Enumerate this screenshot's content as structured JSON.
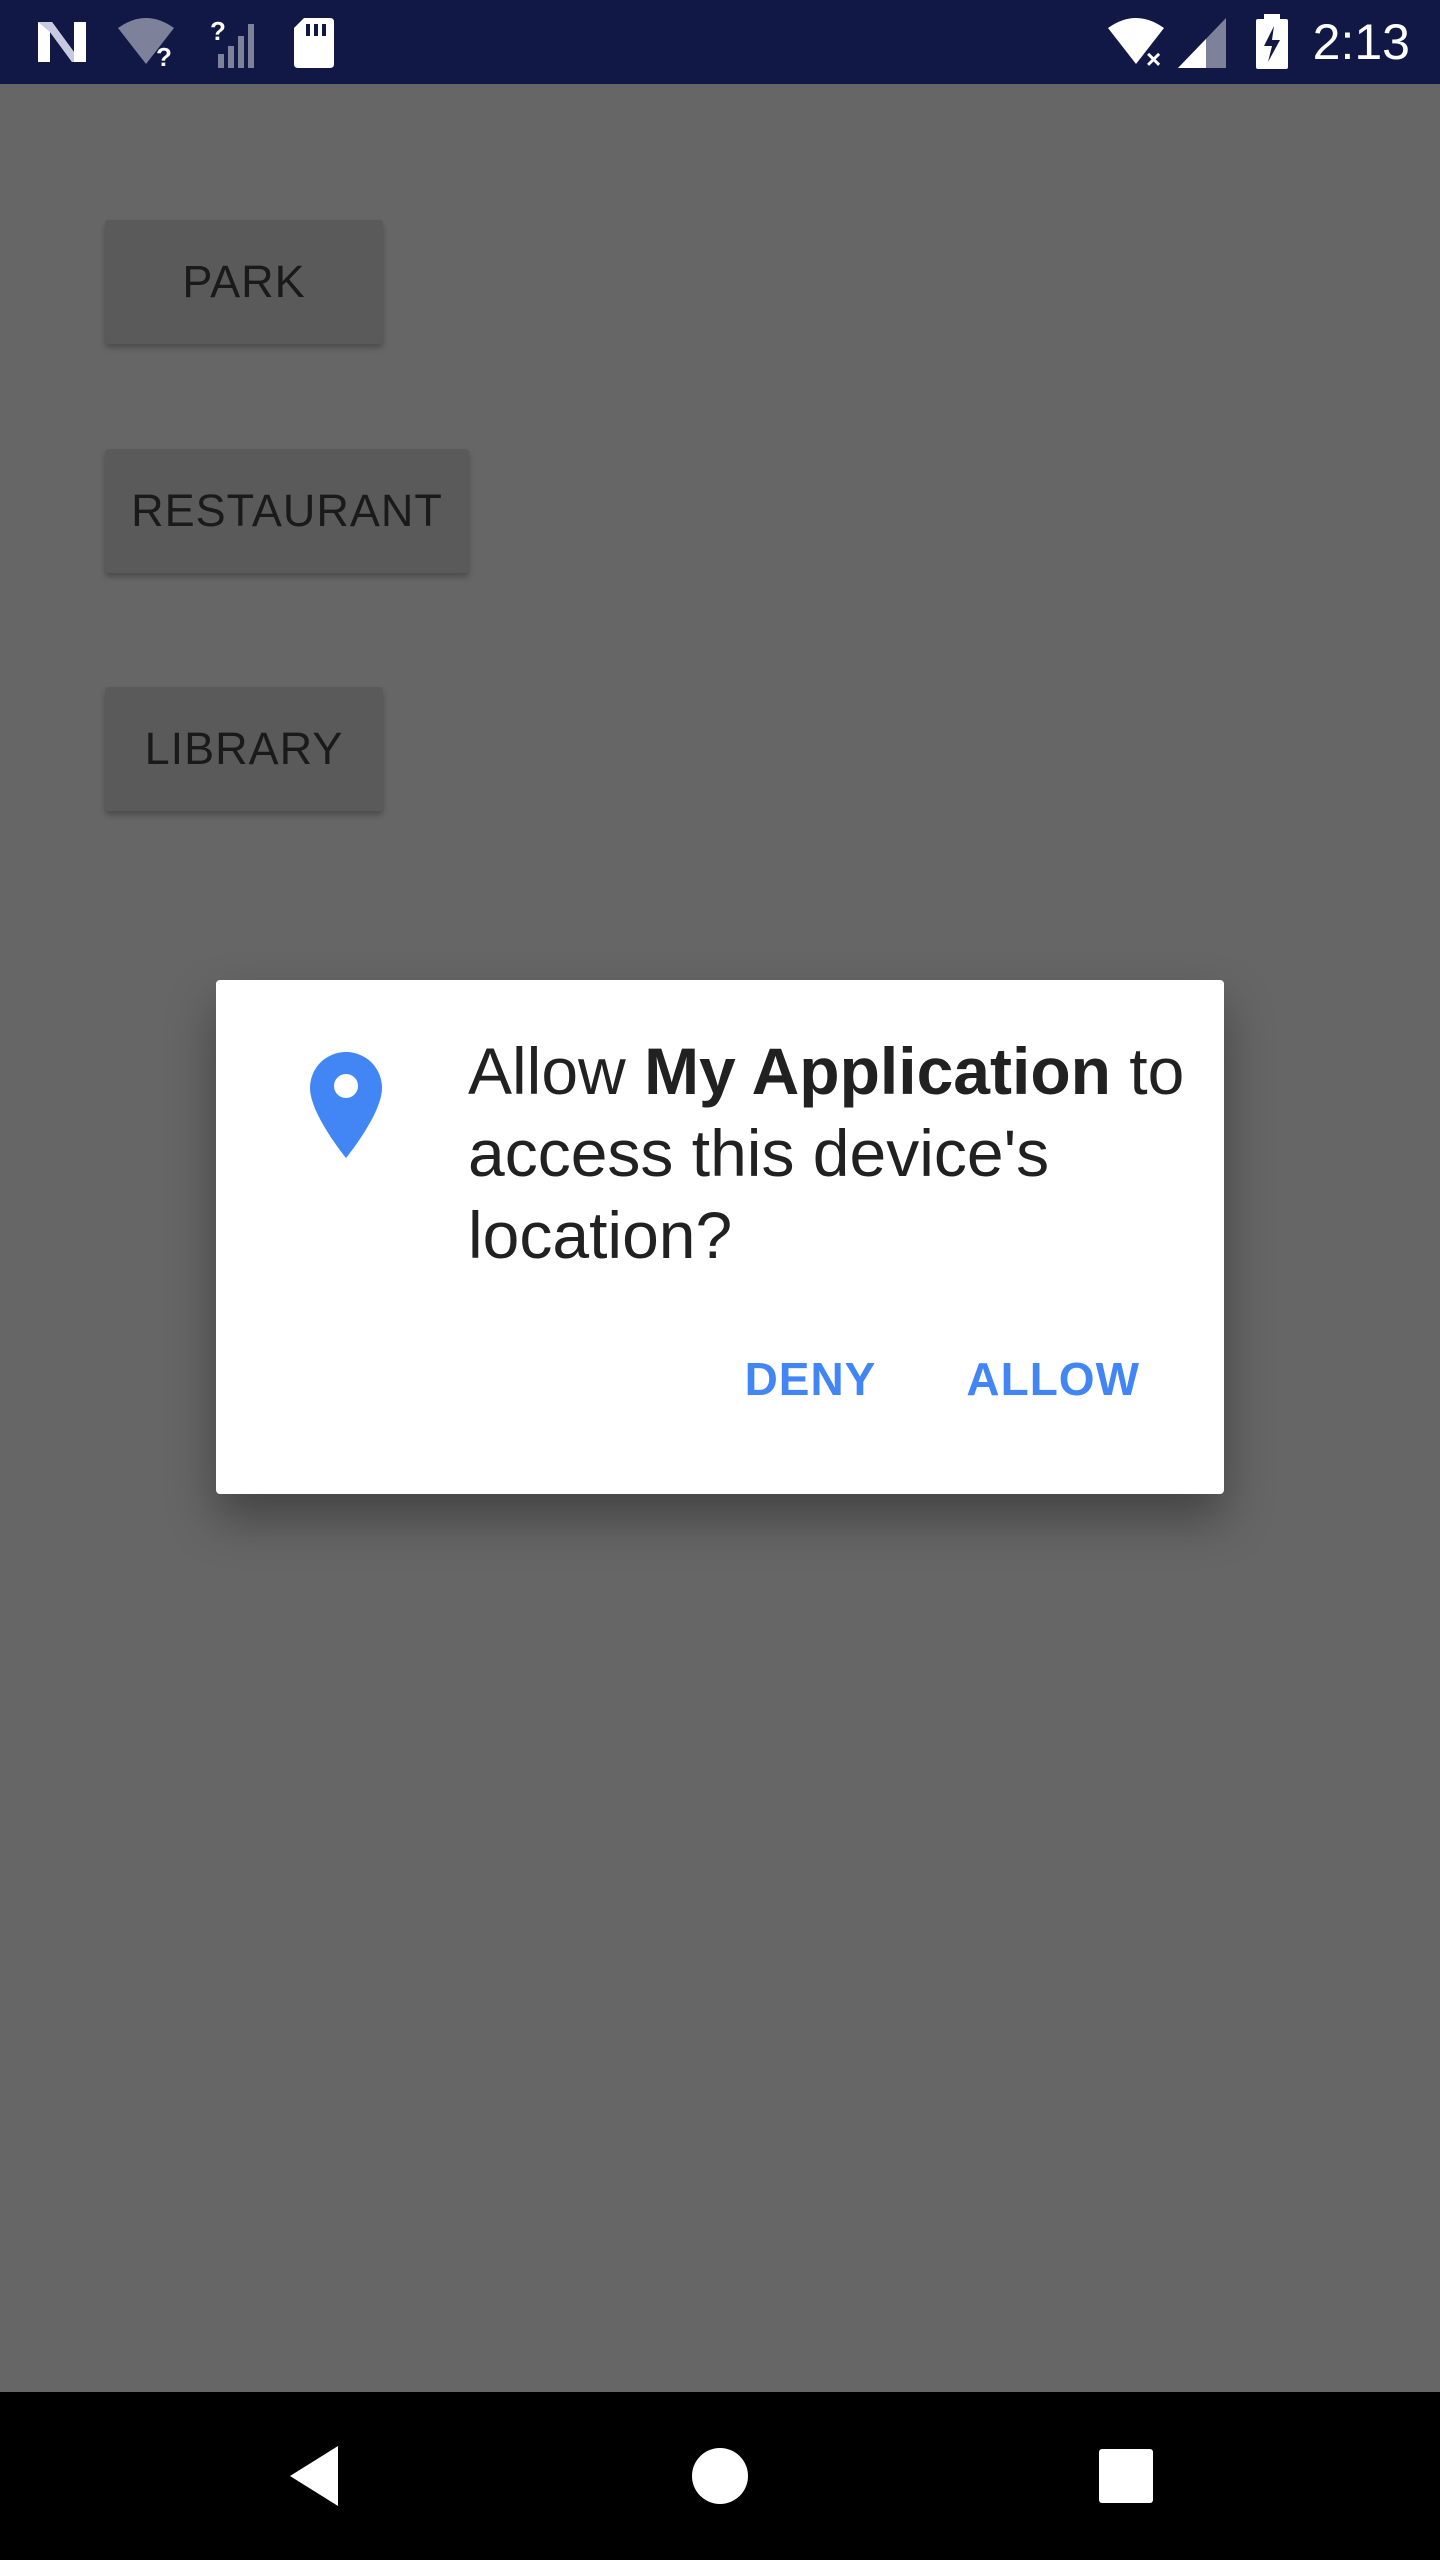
{
  "status_bar": {
    "time": "2:13",
    "icons": [
      "notification-n-icon",
      "wifi-unknown-icon",
      "signal-unknown-icon",
      "sd-card-icon",
      "wifi-no-internet-icon",
      "cell-signal-icon",
      "battery-charging-icon"
    ],
    "background_color": "#111845"
  },
  "app": {
    "buttons": [
      {
        "label": "PARK"
      },
      {
        "label": "RESTAURANT"
      },
      {
        "label": "LIBRARY"
      }
    ]
  },
  "dialog": {
    "icon": "location-pin-icon",
    "message_prefix": "Allow ",
    "app_name": "My Application",
    "message_suffix": " to access this device's location?",
    "deny_label": "DENY",
    "allow_label": "ALLOW",
    "accent_color": "#4285f4"
  },
  "nav_bar": {
    "buttons": [
      "back-icon",
      "home-icon",
      "recents-icon"
    ]
  }
}
